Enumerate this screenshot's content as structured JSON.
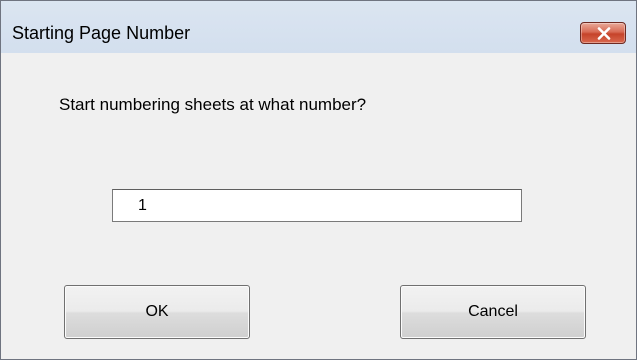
{
  "dialog": {
    "title": "Starting Page Number",
    "close_icon": "close-icon",
    "prompt": "Start numbering sheets at what number?",
    "input_value": "1",
    "ok_label": "OK",
    "cancel_label": "Cancel"
  },
  "colors": {
    "titlebar": "#dbe5f1",
    "client": "#f0f0f0",
    "close_button": "#c6432a"
  }
}
